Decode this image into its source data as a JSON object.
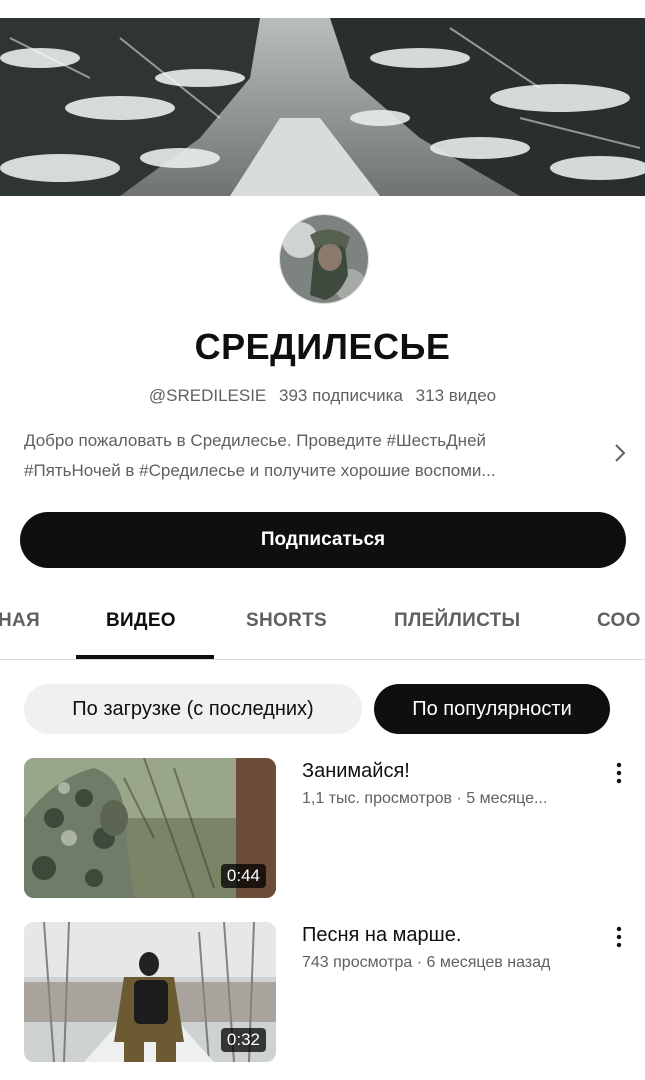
{
  "channel": {
    "name": "СРЕДИЛЕСЬЕ",
    "handle": "@SREDILESIE",
    "subscribers": "393 подписчика",
    "videos_count": "313 видео",
    "description_line1": "Добро пожаловать в Средилесье. Проведите #ШестьДней",
    "description_line2": "#ПятьНочей в #Средилесье и получите хорошие воспоми..."
  },
  "subscribe_label": "Подписаться",
  "tabs": [
    {
      "label": "НАЯ"
    },
    {
      "label": "ВИДЕО"
    },
    {
      "label": "SHORTS"
    },
    {
      "label": "ПЛЕЙЛИСТЫ"
    },
    {
      "label": "СОО"
    }
  ],
  "active_tab": "ВИДЕО",
  "sort_chips": [
    {
      "label": "По загрузке (с последних)",
      "selected": false
    },
    {
      "label": "По популярности",
      "selected": true
    }
  ],
  "videos": [
    {
      "title": "Занимайся!",
      "meta": "1,1 тыс. просмотров · 5 месяце...",
      "duration": "0:44"
    },
    {
      "title": "Песня на марше.",
      "meta": "743 просмотра · 6 месяцев назад",
      "duration": "0:32"
    }
  ],
  "icons": {
    "description_expand": "chevron-right-icon",
    "video_menu": "more-vert-icon"
  }
}
